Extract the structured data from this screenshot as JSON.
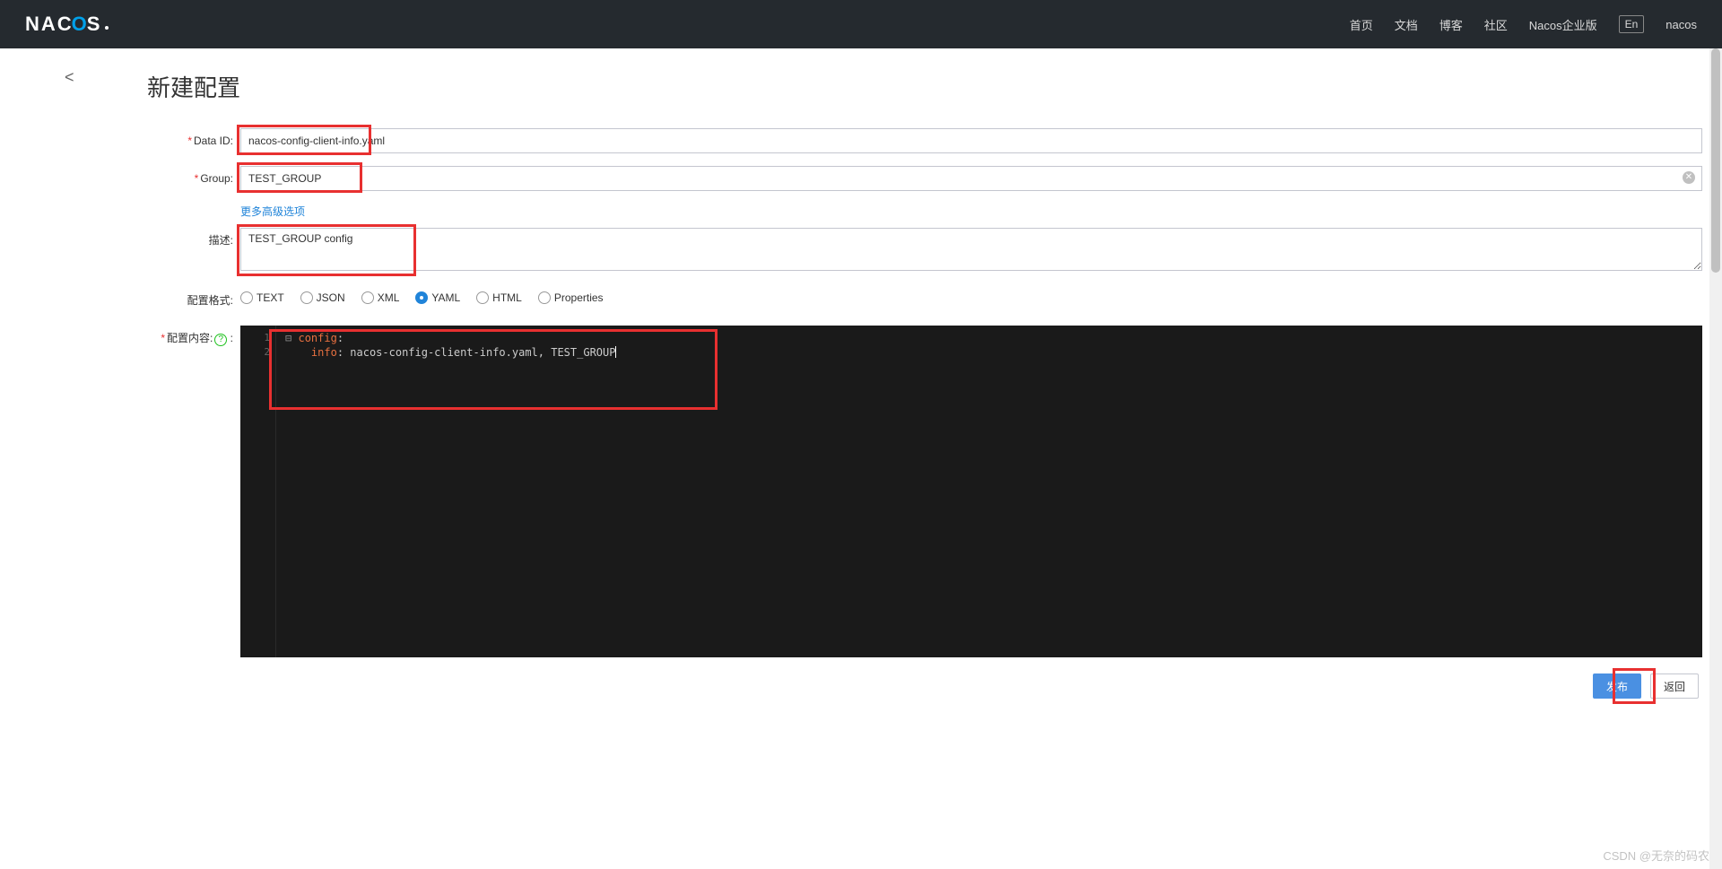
{
  "topbar": {
    "logo": "NACOS",
    "nav": [
      "首页",
      "文档",
      "博客",
      "社区",
      "Nacos企业版"
    ],
    "lang": "En",
    "user": "nacos"
  },
  "page": {
    "title": "新建配置",
    "back_arrow": "<"
  },
  "form": {
    "data_id": {
      "label": "Data ID:",
      "value": "nacos-config-client-info.yaml"
    },
    "group": {
      "label": "Group:",
      "value": "TEST_GROUP"
    },
    "advanced": "更多高级选项",
    "description": {
      "label": "描述:",
      "value": "TEST_GROUP config"
    },
    "format": {
      "label": "配置格式:",
      "options": [
        "TEXT",
        "JSON",
        "XML",
        "YAML",
        "HTML",
        "Properties"
      ],
      "selected": "YAML"
    },
    "content": {
      "label": "配置内容:",
      "code_line1_key": "config",
      "code_line2_key": "info",
      "code_line2_val": "nacos-config-client-info.yaml, TEST_GROUP"
    }
  },
  "footer": {
    "publish": "发布",
    "back": "返回"
  },
  "watermark": "CSDN @无奈的码农"
}
